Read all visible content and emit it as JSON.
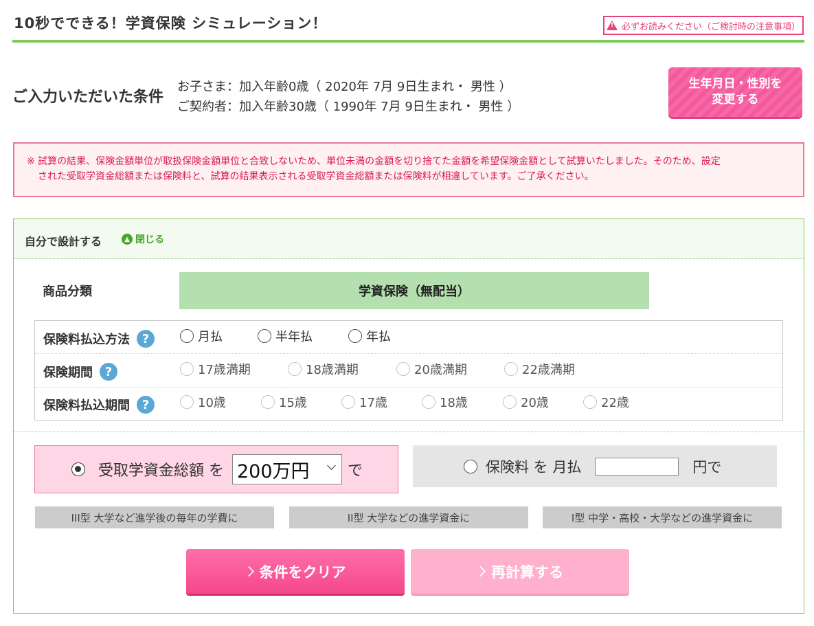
{
  "header": {
    "title": "10秒でできる！学資保険 シミュレーション！",
    "notice_link": "必ずお読みください（ご検討時の注意事項）"
  },
  "conditions": {
    "heading": "ご入力いただいた条件",
    "child_line": "お子さま：加入年齢0歳（ 2020年 7月 9日生まれ・ 男性 ）",
    "contractor_line": "ご契約者：加入年齢30歳（ 1990年 7月 9日生まれ・ 男性 ）",
    "change_button_line1": "生年月日・性別を",
    "change_button_line2": "変更する"
  },
  "warning": {
    "line1": "※ 試算の結果、保険金額単位が取扱保険金額単位と合致しないため、単位未満の金額を切り捨てた金額を希望保険金額として試算いたしました。そのため、設定",
    "line2": "された受取学資金総額または保険料と、試算の結果表示される受取学資金総額または保険料が相違しています。ご了承ください。"
  },
  "design_panel": {
    "title": "自分で設計する",
    "close_label": "閉じる",
    "product_label": "商品分類",
    "product_value": "学資保険（無配当）",
    "payment_method": {
      "label": "保険料払込方法",
      "options": [
        "月払",
        "半年払",
        "年払"
      ]
    },
    "insurance_period": {
      "label": "保険期間",
      "options": [
        "17歳満期",
        "18歳満期",
        "20歳満期",
        "22歳満期"
      ]
    },
    "payment_period": {
      "label": "保険料払込期間",
      "options": [
        "10歳",
        "15歳",
        "17歳",
        "18歳",
        "20歳",
        "22歳"
      ]
    },
    "amount_option": {
      "prefix": "受取学資金総額 を",
      "selected_value": "200万円",
      "suffix": "で",
      "selected": true
    },
    "premium_option": {
      "prefix": "保険料 を 月払",
      "input_value": "",
      "suffix": "円で",
      "selected": false
    },
    "type_buttons": [
      "III型 大学など進学後の毎年の学費に",
      "II型 大学などの進学資金に",
      "I型 中学・高校・大学などの進学資金に"
    ],
    "clear_button": "条件をクリア",
    "recalc_button": "再計算する"
  },
  "colors": {
    "accent_green": "#7dc95a",
    "accent_pink": "#f5478c",
    "warning_red": "#d81c4c"
  }
}
